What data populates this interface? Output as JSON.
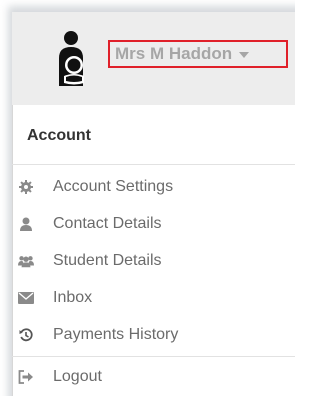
{
  "user_menu": {
    "name": "Mrs M Haddon",
    "avatar_icon": "parent-with-child-icon"
  },
  "account_menu": {
    "heading": "Account",
    "items": [
      {
        "label": "Account Settings",
        "icon": "gear-icon"
      },
      {
        "label": "Contact Details",
        "icon": "user-icon"
      },
      {
        "label": "Student Details",
        "icon": "users-icon"
      },
      {
        "label": "Inbox",
        "icon": "envelope-icon"
      },
      {
        "label": "Payments History",
        "icon": "history-icon"
      },
      {
        "label": "Logout",
        "icon": "sign-out-icon"
      }
    ]
  },
  "colors": {
    "highlight_border": "#e0202a",
    "username_text": "#a6a6a6",
    "header_bg": "#ededed",
    "icon_gray": "#8a8a8a"
  }
}
